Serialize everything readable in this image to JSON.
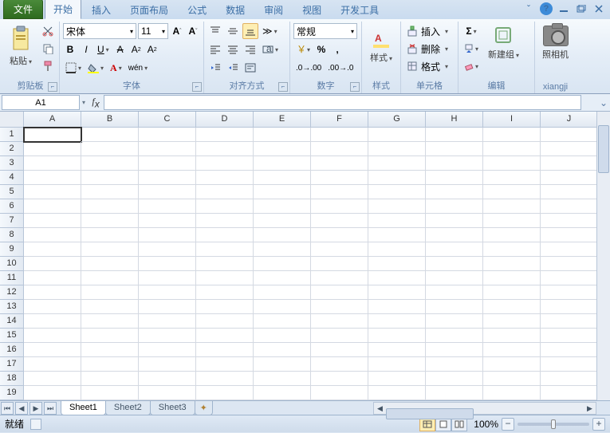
{
  "tabs": {
    "file": "文件",
    "home": "开始",
    "insert": "插入",
    "layout": "页面布局",
    "formula": "公式",
    "data": "数据",
    "review": "审阅",
    "view": "视图",
    "dev": "开发工具"
  },
  "ribbon": {
    "clipboard": {
      "label": "剪贴板",
      "paste": "粘贴"
    },
    "font": {
      "label": "字体",
      "name": "宋体",
      "size": "11"
    },
    "align": {
      "label": "对齐方式"
    },
    "number": {
      "label": "数字",
      "format": "常规"
    },
    "styles": {
      "label": "样式",
      "btn": "样式"
    },
    "cells": {
      "label": "单元格",
      "insert": "插入",
      "delete": "删除",
      "format": "格式"
    },
    "editing": {
      "label": "编辑",
      "newgroup": "新建组"
    },
    "camera": {
      "label": "xiangji",
      "btn": "照相机"
    }
  },
  "namebox": "A1",
  "columns": [
    "A",
    "B",
    "C",
    "D",
    "E",
    "F",
    "G",
    "H",
    "I",
    "J"
  ],
  "rows": [
    "1",
    "2",
    "3",
    "4",
    "5",
    "6",
    "7",
    "8",
    "9",
    "10",
    "11",
    "12",
    "13",
    "14",
    "15",
    "16",
    "17",
    "18",
    "19"
  ],
  "sheets": {
    "s1": "Sheet1",
    "s2": "Sheet2",
    "s3": "Sheet3"
  },
  "status": {
    "ready": "就绪",
    "zoom": "100%"
  }
}
